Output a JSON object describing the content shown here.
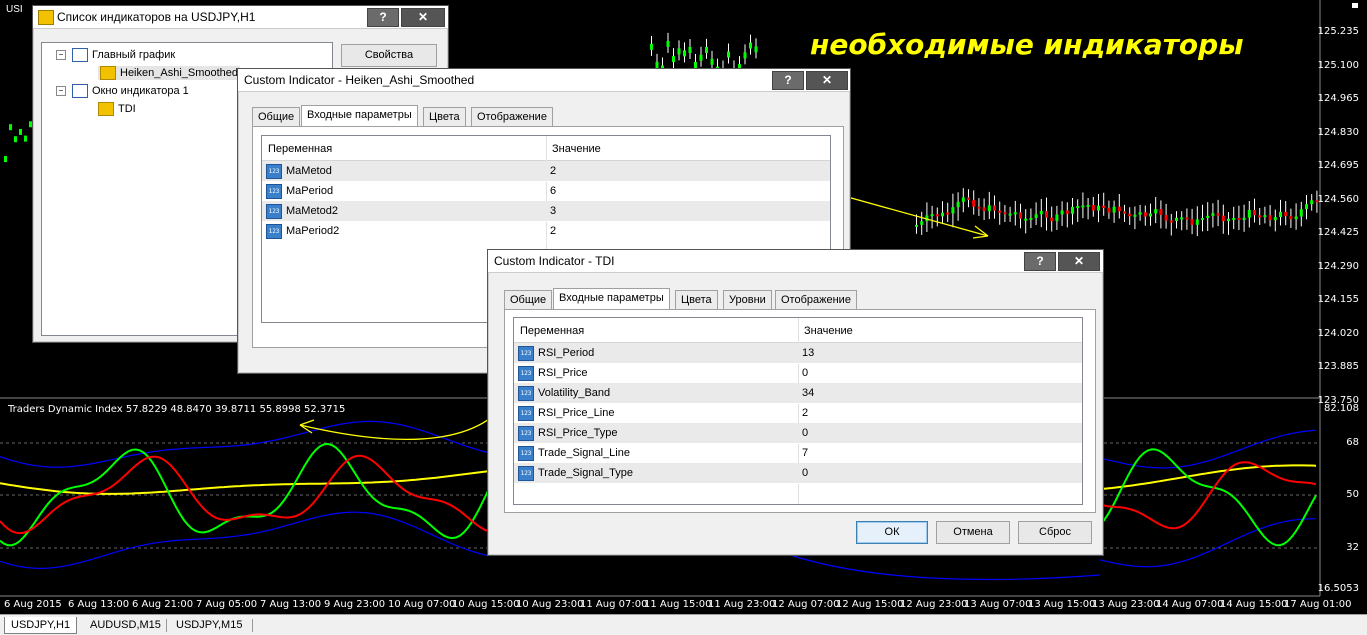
{
  "chart": {
    "overlay_caption": "необходимые индикаторы",
    "indicator_label": "Traders Dynamic Index 57.8229 48.8470 39.8711 55.8998 52.3715",
    "symbol_partial": "USI",
    "price_axis": [
      "125.235",
      "125.100",
      "124.965",
      "124.830",
      "124.695",
      "124.560",
      "124.425",
      "124.290",
      "124.155",
      "124.020",
      "123.885",
      "123.750"
    ],
    "indicator_axis": [
      "82.108",
      "68",
      "50",
      "32",
      "16.5053"
    ],
    "time_axis": [
      "6 Aug 2015",
      "6 Aug 13:00",
      "6 Aug 21:00",
      "7 Aug 05:00",
      "7 Aug 13:00",
      "9 Aug 23:00",
      "10 Aug 07:00",
      "10 Aug 15:00",
      "10 Aug 23:00",
      "11 Aug 07:00",
      "11 Aug 15:00",
      "11 Aug 23:00",
      "12 Aug 07:00",
      "12 Aug 15:00",
      "12 Aug 23:00",
      "13 Aug 07:00",
      "13 Aug 15:00",
      "13 Aug 23:00",
      "14 Aug 07:00",
      "14 Aug 15:00",
      "17 Aug 01:00"
    ],
    "colors": {
      "up": "#00ff00",
      "down": "#ff0000",
      "band": "#0000ff",
      "signal": "#ffff00",
      "rsi_line": "#00ff00",
      "price_line": "#ff0000"
    }
  },
  "bottom_tabs": [
    "USDJPY,H1",
    "AUDUSD,M15",
    "USDJPY,M15"
  ],
  "indicator_list_window": {
    "title": "Список индикаторов на USDJPY,H1",
    "help_btn": "?",
    "close_btn": "✕",
    "properties_btn": "Свойства",
    "tree": [
      {
        "label": "Главный график",
        "level": 0
      },
      {
        "label": "Heiken_Ashi_Smoothed",
        "level": 1
      },
      {
        "label": "Окно индикатора 1",
        "level": 0
      },
      {
        "label": "TDI",
        "level": 1
      }
    ]
  },
  "heiken_window": {
    "title": "Custom Indicator - Heiken_Ashi_Smoothed",
    "help_btn": "?",
    "close_btn": "✕",
    "tabs": [
      "Общие",
      "Входные параметры",
      "Цвета",
      "Отображение"
    ],
    "active_tab": 1,
    "col_variable": "Переменная",
    "col_value": "Значение",
    "params": [
      {
        "name": "MaMetod",
        "value": "2"
      },
      {
        "name": "MaPeriod",
        "value": "6"
      },
      {
        "name": "MaMetod2",
        "value": "3"
      },
      {
        "name": "MaPeriod2",
        "value": "2"
      }
    ]
  },
  "tdi_window": {
    "title": "Custom Indicator - TDI",
    "help_btn": "?",
    "close_btn": "✕",
    "tabs": [
      "Общие",
      "Входные параметры",
      "Цвета",
      "Уровни",
      "Отображение"
    ],
    "active_tab": 1,
    "col_variable": "Переменная",
    "col_value": "Значение",
    "params": [
      {
        "name": "RSI_Period",
        "value": "13"
      },
      {
        "name": "RSI_Price",
        "value": "0"
      },
      {
        "name": "Volatility_Band",
        "value": "34"
      },
      {
        "name": "RSI_Price_Line",
        "value": "2"
      },
      {
        "name": "RSI_Price_Type",
        "value": "0"
      },
      {
        "name": "Trade_Signal_Line",
        "value": "7"
      },
      {
        "name": "Trade_Signal_Type",
        "value": "0"
      }
    ],
    "ok_btn": "ОК",
    "cancel_btn": "Отмена",
    "reset_btn": "Сброс"
  },
  "param_icon_text": "123"
}
